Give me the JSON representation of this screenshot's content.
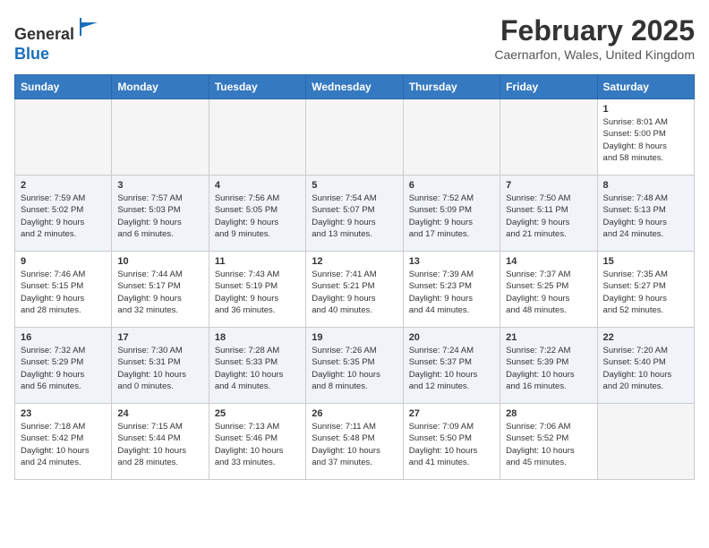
{
  "header": {
    "logo_general": "General",
    "logo_blue": "Blue",
    "month_year": "February 2025",
    "location": "Caernarfon, Wales, United Kingdom"
  },
  "days_of_week": [
    "Sunday",
    "Monday",
    "Tuesday",
    "Wednesday",
    "Thursday",
    "Friday",
    "Saturday"
  ],
  "weeks": [
    [
      {
        "day": "",
        "detail": ""
      },
      {
        "day": "",
        "detail": ""
      },
      {
        "day": "",
        "detail": ""
      },
      {
        "day": "",
        "detail": ""
      },
      {
        "day": "",
        "detail": ""
      },
      {
        "day": "",
        "detail": ""
      },
      {
        "day": "1",
        "detail": "Sunrise: 8:01 AM\nSunset: 5:00 PM\nDaylight: 8 hours\nand 58 minutes."
      }
    ],
    [
      {
        "day": "2",
        "detail": "Sunrise: 7:59 AM\nSunset: 5:02 PM\nDaylight: 9 hours\nand 2 minutes."
      },
      {
        "day": "3",
        "detail": "Sunrise: 7:57 AM\nSunset: 5:03 PM\nDaylight: 9 hours\nand 6 minutes."
      },
      {
        "day": "4",
        "detail": "Sunrise: 7:56 AM\nSunset: 5:05 PM\nDaylight: 9 hours\nand 9 minutes."
      },
      {
        "day": "5",
        "detail": "Sunrise: 7:54 AM\nSunset: 5:07 PM\nDaylight: 9 hours\nand 13 minutes."
      },
      {
        "day": "6",
        "detail": "Sunrise: 7:52 AM\nSunset: 5:09 PM\nDaylight: 9 hours\nand 17 minutes."
      },
      {
        "day": "7",
        "detail": "Sunrise: 7:50 AM\nSunset: 5:11 PM\nDaylight: 9 hours\nand 21 minutes."
      },
      {
        "day": "8",
        "detail": "Sunrise: 7:48 AM\nSunset: 5:13 PM\nDaylight: 9 hours\nand 24 minutes."
      }
    ],
    [
      {
        "day": "9",
        "detail": "Sunrise: 7:46 AM\nSunset: 5:15 PM\nDaylight: 9 hours\nand 28 minutes."
      },
      {
        "day": "10",
        "detail": "Sunrise: 7:44 AM\nSunset: 5:17 PM\nDaylight: 9 hours\nand 32 minutes."
      },
      {
        "day": "11",
        "detail": "Sunrise: 7:43 AM\nSunset: 5:19 PM\nDaylight: 9 hours\nand 36 minutes."
      },
      {
        "day": "12",
        "detail": "Sunrise: 7:41 AM\nSunset: 5:21 PM\nDaylight: 9 hours\nand 40 minutes."
      },
      {
        "day": "13",
        "detail": "Sunrise: 7:39 AM\nSunset: 5:23 PM\nDaylight: 9 hours\nand 44 minutes."
      },
      {
        "day": "14",
        "detail": "Sunrise: 7:37 AM\nSunset: 5:25 PM\nDaylight: 9 hours\nand 48 minutes."
      },
      {
        "day": "15",
        "detail": "Sunrise: 7:35 AM\nSunset: 5:27 PM\nDaylight: 9 hours\nand 52 minutes."
      }
    ],
    [
      {
        "day": "16",
        "detail": "Sunrise: 7:32 AM\nSunset: 5:29 PM\nDaylight: 9 hours\nand 56 minutes."
      },
      {
        "day": "17",
        "detail": "Sunrise: 7:30 AM\nSunset: 5:31 PM\nDaylight: 10 hours\nand 0 minutes."
      },
      {
        "day": "18",
        "detail": "Sunrise: 7:28 AM\nSunset: 5:33 PM\nDaylight: 10 hours\nand 4 minutes."
      },
      {
        "day": "19",
        "detail": "Sunrise: 7:26 AM\nSunset: 5:35 PM\nDaylight: 10 hours\nand 8 minutes."
      },
      {
        "day": "20",
        "detail": "Sunrise: 7:24 AM\nSunset: 5:37 PM\nDaylight: 10 hours\nand 12 minutes."
      },
      {
        "day": "21",
        "detail": "Sunrise: 7:22 AM\nSunset: 5:39 PM\nDaylight: 10 hours\nand 16 minutes."
      },
      {
        "day": "22",
        "detail": "Sunrise: 7:20 AM\nSunset: 5:40 PM\nDaylight: 10 hours\nand 20 minutes."
      }
    ],
    [
      {
        "day": "23",
        "detail": "Sunrise: 7:18 AM\nSunset: 5:42 PM\nDaylight: 10 hours\nand 24 minutes."
      },
      {
        "day": "24",
        "detail": "Sunrise: 7:15 AM\nSunset: 5:44 PM\nDaylight: 10 hours\nand 28 minutes."
      },
      {
        "day": "25",
        "detail": "Sunrise: 7:13 AM\nSunset: 5:46 PM\nDaylight: 10 hours\nand 33 minutes."
      },
      {
        "day": "26",
        "detail": "Sunrise: 7:11 AM\nSunset: 5:48 PM\nDaylight: 10 hours\nand 37 minutes."
      },
      {
        "day": "27",
        "detail": "Sunrise: 7:09 AM\nSunset: 5:50 PM\nDaylight: 10 hours\nand 41 minutes."
      },
      {
        "day": "28",
        "detail": "Sunrise: 7:06 AM\nSunset: 5:52 PM\nDaylight: 10 hours\nand 45 minutes."
      },
      {
        "day": "",
        "detail": ""
      }
    ]
  ]
}
